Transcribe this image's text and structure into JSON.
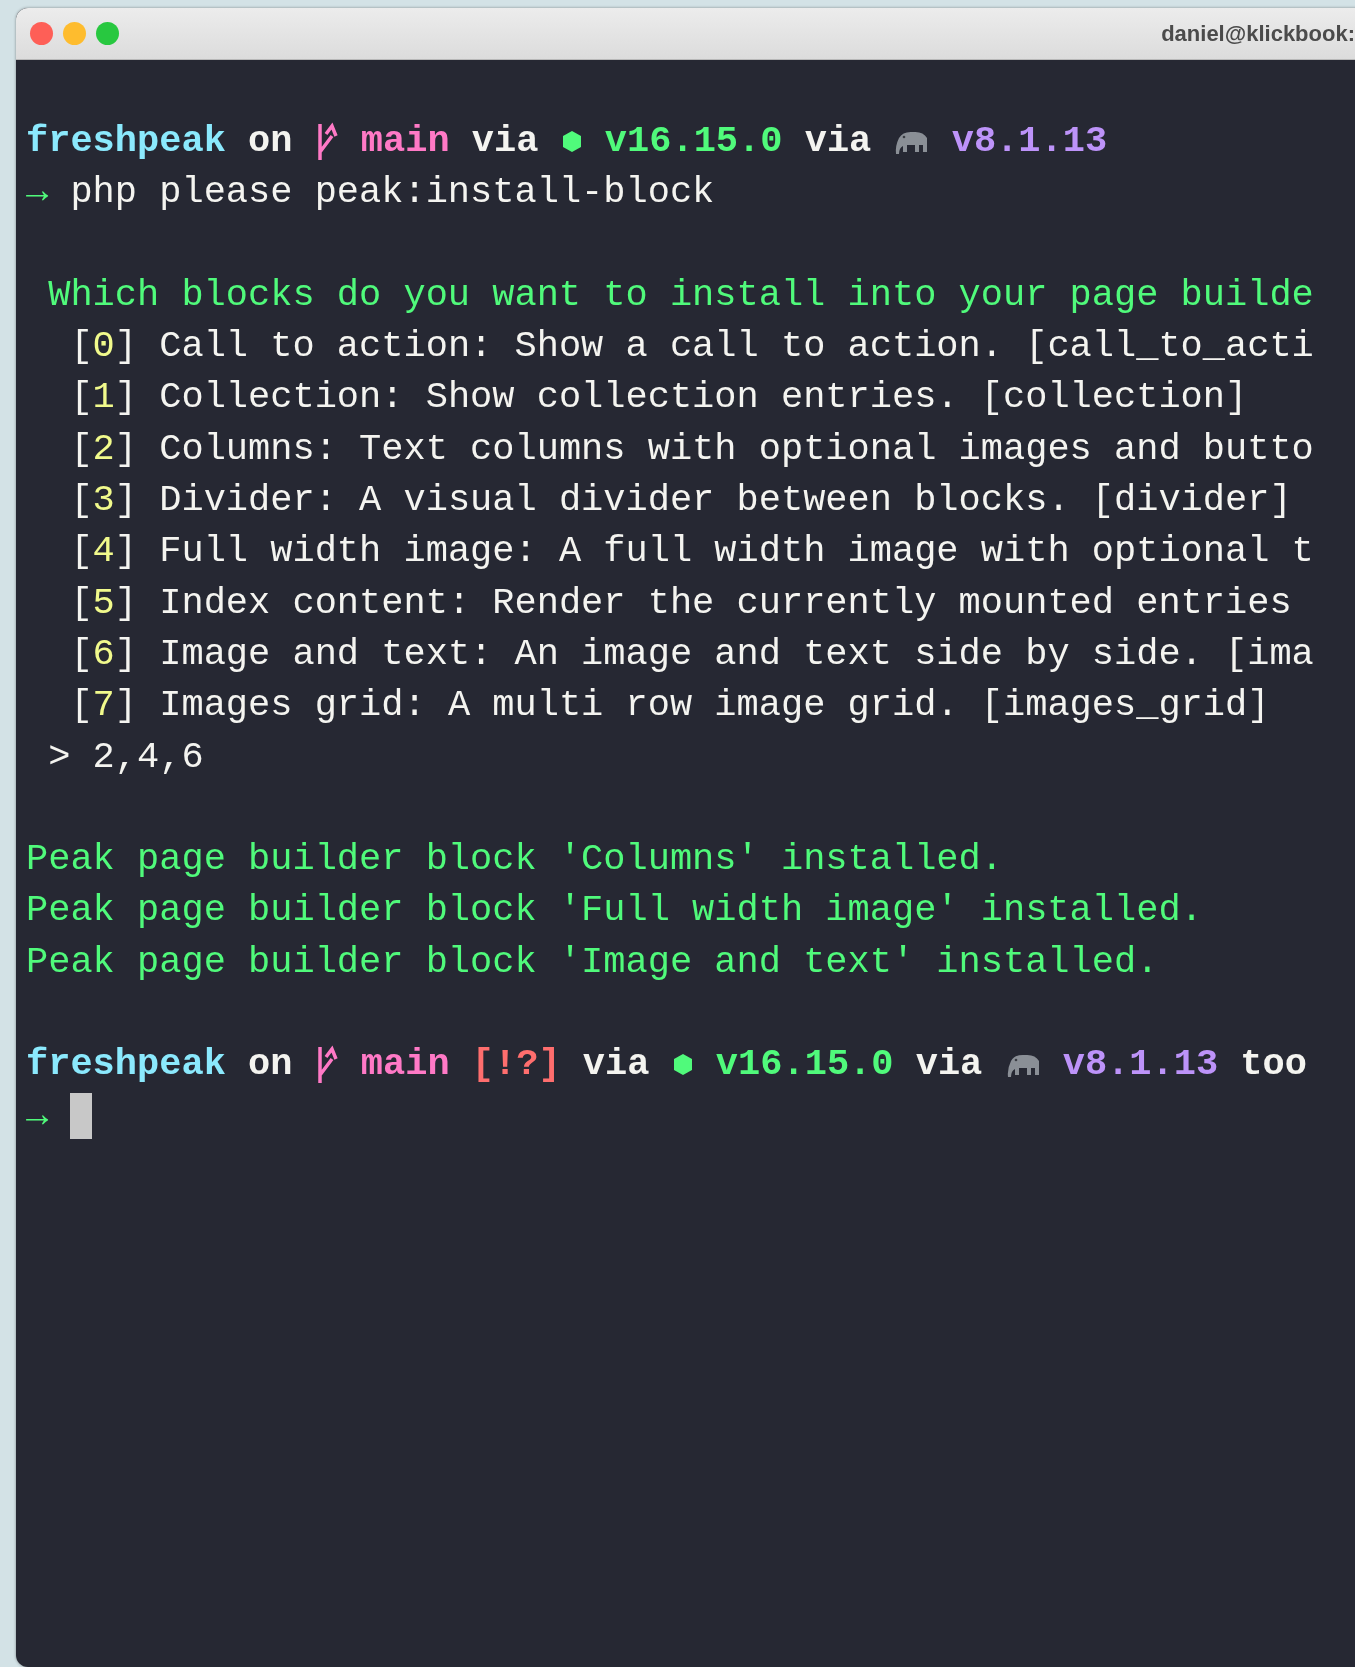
{
  "window": {
    "title": "daniel@klickbook:"
  },
  "lines": [
    {
      "kind": "prompt",
      "dir": "freshpeak",
      "on": "on",
      "branch": "main",
      "via": "via",
      "node_version": "v16.15.0",
      "via_2": "via",
      "php_version": "v8.1.13"
    },
    {
      "kind": "command",
      "arrow": "→",
      "text": "php please peak:install-block"
    },
    {
      "kind": "spacer"
    },
    {
      "kind": "question",
      "text": "Which blocks do you want to install into your page builde"
    },
    {
      "kind": "option",
      "index": "[0]",
      "text": "Call to action: Show a call to action. [call_to_acti"
    },
    {
      "kind": "option",
      "index": "[1]",
      "text": "Collection: Show collection entries. [collection]"
    },
    {
      "kind": "option",
      "index": "[2]",
      "text": "Columns: Text columns with optional images and butto"
    },
    {
      "kind": "option",
      "index": "[3]",
      "text": "Divider: A visual divider between blocks. [divider]"
    },
    {
      "kind": "option",
      "index": "[4]",
      "text": "Full width image: A full width image with optional t"
    },
    {
      "kind": "option",
      "index": "[5]",
      "text": "Index content: Render the currently mounted entries"
    },
    {
      "kind": "option",
      "index": "[6]",
      "text": "Image and text: An image and text side by side. [ima"
    },
    {
      "kind": "option",
      "index": "[7]",
      "text": "Images grid: A multi row image grid. [images_grid]"
    },
    {
      "kind": "answer",
      "text": "> 2,4,6"
    },
    {
      "kind": "spacer"
    },
    {
      "kind": "success",
      "text": "Peak page builder block 'Columns' installed."
    },
    {
      "kind": "success",
      "text": "Peak page builder block 'Full width image' installed."
    },
    {
      "kind": "success",
      "text": "Peak page builder block 'Image and text' installed."
    },
    {
      "kind": "spacer"
    },
    {
      "kind": "prompt",
      "dir": "freshpeak",
      "on": "on",
      "branch": "main",
      "status": "[!?]",
      "via": "via",
      "node_version": "v16.15.0",
      "via_2": "via",
      "php_version": "v8.1.13",
      "trailing": "too"
    },
    {
      "kind": "input",
      "arrow": "→"
    }
  ]
}
